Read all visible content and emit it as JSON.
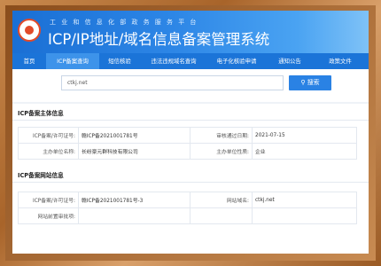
{
  "header": {
    "subtitle": "工业和信息化部政务服务平台",
    "title": "ICP/IP地址/域名信息备案管理系统"
  },
  "nav": {
    "items": [
      {
        "label": "首页"
      },
      {
        "label": "ICP备案查询"
      },
      {
        "label": "短信核验"
      },
      {
        "label": "违法违规域名查询"
      },
      {
        "label": "电子化核验申请"
      },
      {
        "label": "通知公告"
      },
      {
        "label": "政策文件"
      }
    ],
    "active_index": 1
  },
  "search": {
    "value": "ctkj.net",
    "button_label": "搜索"
  },
  "subject_section": {
    "title": "ICP备案主体信息",
    "rows": [
      {
        "label1": "ICP备案/许可证号:",
        "value1": "赣ICP备2021001781号",
        "label2": "审核通过日期:",
        "value2": "2021-07-15"
      },
      {
        "label1": "主办单位名称:",
        "value1": "长纷豪元群科技有限公司",
        "label2": "主办单位性质:",
        "value2": "企业"
      }
    ]
  },
  "website_section": {
    "title": "ICP备案网站信息",
    "rows": [
      {
        "label1": "ICP备案/许可证号:",
        "value1": "赣ICP备2021001781号-3",
        "label2": "网站域名:",
        "value2": "ctkj.net"
      },
      {
        "label1": "网站前置审批项:",
        "value1": "",
        "label2": "",
        "value2": ""
      }
    ]
  }
}
